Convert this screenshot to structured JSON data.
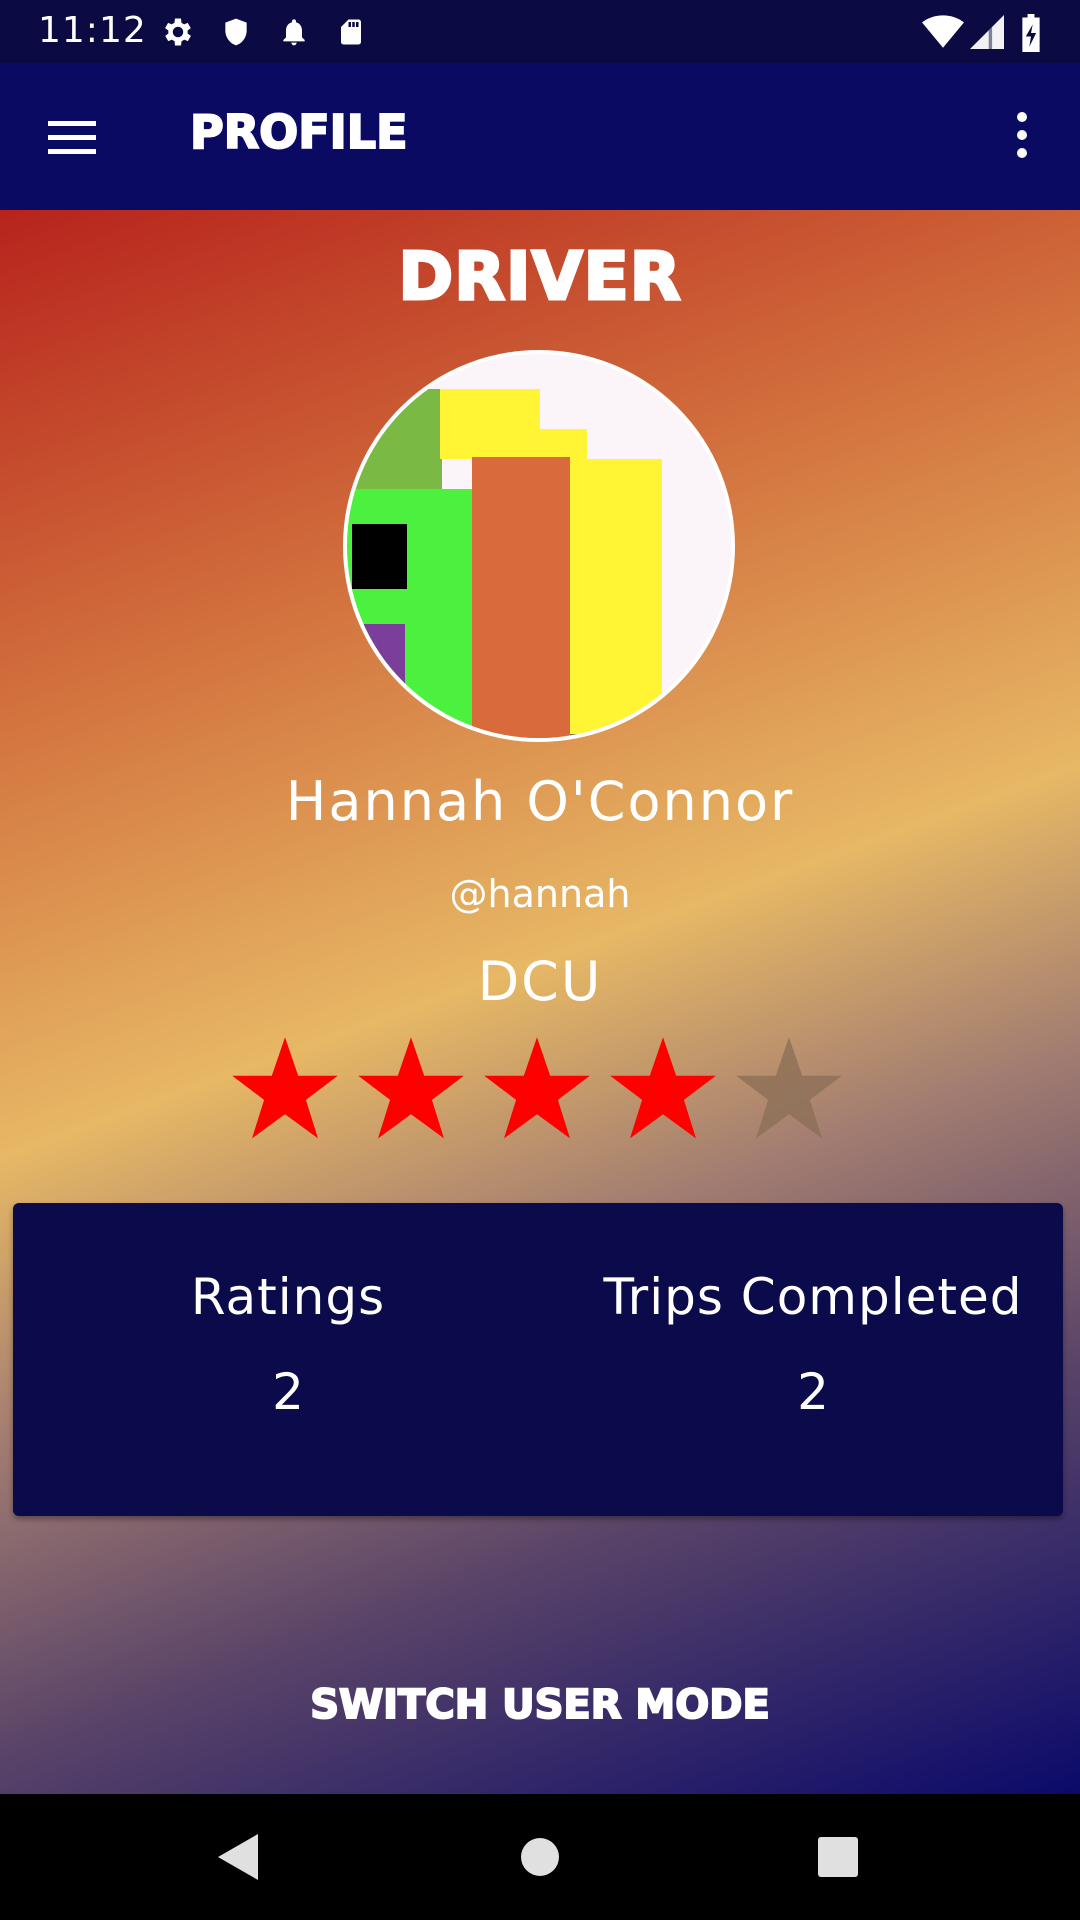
{
  "status_bar": {
    "time": "11:12",
    "left_icons": [
      "gear-icon",
      "shield-icon",
      "bell-icon",
      "sd-card-icon"
    ],
    "right_icons": [
      "wifi-icon",
      "signal-icon",
      "battery-icon"
    ]
  },
  "app_bar": {
    "title": "Profile",
    "menu_icon": "hamburger-menu-icon",
    "overflow_icon": "more-vert-icon"
  },
  "profile": {
    "mode": "DRIVER",
    "name": "Hannah O'Connor",
    "handle": "@hannah",
    "organization": "DCU",
    "rating": {
      "value": 4,
      "max": 5,
      "filled_color": "#ff0000",
      "empty_color": "#8a6d55"
    }
  },
  "stats": {
    "ratings_label": "Ratings",
    "ratings_value": "2",
    "trips_label": "Trips Completed",
    "trips_value": "2"
  },
  "actions": {
    "switch_mode_label": "SWITCH USER MODE"
  },
  "colors": {
    "app_bar": "#0b0a62",
    "status_bar": "#0b0a42",
    "card": "#0b0a4a"
  },
  "nav_bar": {
    "icons": [
      "back-icon",
      "home-icon",
      "recents-icon"
    ]
  }
}
